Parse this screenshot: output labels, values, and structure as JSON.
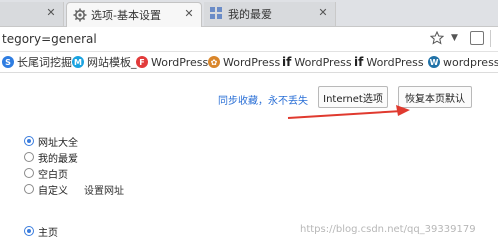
{
  "tabs": [
    {
      "label": "",
      "active": false
    },
    {
      "label": "选项-基本设置",
      "active": true,
      "icon": "gear-icon"
    },
    {
      "label": "我的最爱",
      "active": false,
      "icon": "grid-icon"
    }
  ],
  "address": {
    "url": "tegory=general"
  },
  "bookmarks": [
    {
      "label": "长尾词挖掘",
      "icon": "s-logo-icon",
      "color": "#2f7de1"
    },
    {
      "label": "网站模板_",
      "icon": "m-logo-icon",
      "color": "#1ba3e0"
    },
    {
      "label": "WordPress",
      "icon": "fp-logo-icon",
      "color": "#e23b3b"
    },
    {
      "label": "WordPress",
      "icon": "pinwheel-icon",
      "color": "#d9862b"
    },
    {
      "label": "WordPress",
      "icon": "if-logo-icon",
      "color": "#222222"
    },
    {
      "label": "WordPress",
      "icon": "if-logo-icon",
      "color": "#222222"
    },
    {
      "label": "wordpress",
      "icon": "wordpress-icon",
      "color": "#2172a7"
    }
  ],
  "content": {
    "sync_link": "同步收藏，永不丢失",
    "internet_options": "Internet选项",
    "restore_defaults": "恢复本页默认",
    "homepage_options": [
      {
        "label": "网址大全",
        "checked": true
      },
      {
        "label": "我的最爱",
        "checked": false
      },
      {
        "label": "空白页",
        "checked": false
      },
      {
        "label": "自定义",
        "checked": false
      }
    ],
    "set_url": "设置网址",
    "startup_option": {
      "label": "主页",
      "checked": true
    }
  },
  "watermark": "https://blog.csdn.net/qq_39339179",
  "colors": {
    "accent": "#3b7ddd",
    "arrow": "#e03a2f",
    "link": "#2a6fd6"
  }
}
